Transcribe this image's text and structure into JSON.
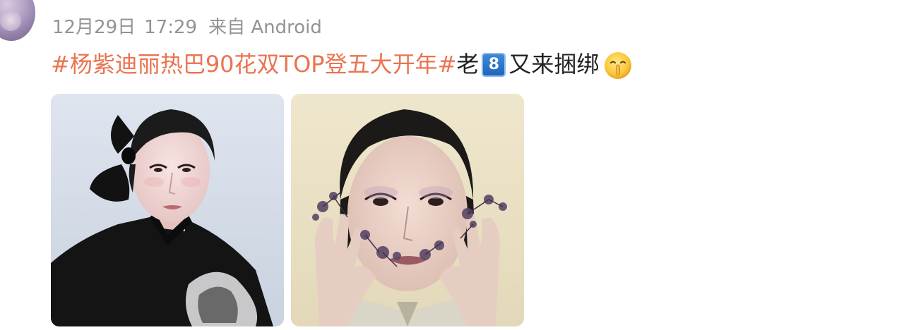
{
  "post": {
    "date": "12月29日",
    "time": "17:29",
    "source": "来自 Android",
    "hashtag": "#杨紫迪丽热巴90花双TOP登五大开年#",
    "text_before_badge": "老",
    "badge": "8",
    "text_after_badge": "又来捆绑",
    "emoji": "shushing-face-icon"
  },
  "colors": {
    "hashtag": "#eb7350",
    "meta": "#939393",
    "body_text": "#222222",
    "background": "#ffffff"
  },
  "photos": [
    {
      "name": "photo-1",
      "description_icon": "portrait-image"
    },
    {
      "name": "photo-2",
      "description_icon": "portrait-image"
    }
  ]
}
